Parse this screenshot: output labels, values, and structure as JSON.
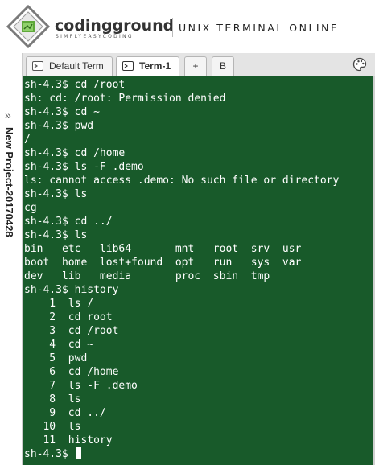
{
  "header": {
    "brand": "codingground",
    "tagline": "SIMPLYEASYCODING",
    "title": "UNIX TERMINAL ONLINE"
  },
  "sidebar": {
    "expand_icon": "double-chevron-right-icon",
    "project_name": "New Project-20170428"
  },
  "tabs": [
    {
      "label": "Default Term",
      "icon": "terminal-icon",
      "active": false
    },
    {
      "label": "Term-1",
      "icon": "terminal-icon",
      "active": true
    }
  ],
  "add_tab_label": "+",
  "b_tab_label": "B",
  "palette_icon": "palette-icon",
  "terminal": {
    "lines": [
      "sh-4.3$ cd /root",
      "sh: cd: /root: Permission denied",
      "sh-4.3$ cd ~",
      "sh-4.3$ pwd",
      "/",
      "sh-4.3$ cd /home",
      "sh-4.3$ ls -F .demo",
      "ls: cannot access .demo: No such file or directory",
      "sh-4.3$ ls",
      "cg",
      "sh-4.3$ cd ../",
      "sh-4.3$ ls",
      "bin   etc   lib64       mnt   root  srv  usr",
      "boot  home  lost+found  opt   run   sys  var",
      "dev   lib   media       proc  sbin  tmp",
      "sh-4.3$ history",
      "    1  ls /",
      "    2  cd root",
      "    3  cd /root",
      "    4  cd ~",
      "    5  pwd",
      "    6  cd /home",
      "    7  ls -F .demo",
      "    8  ls",
      "    9  cd ../",
      "   10  ls",
      "   11  history"
    ],
    "prompt": "sh-4.3$ "
  },
  "colors": {
    "terminal_bg": "#185a2a",
    "terminal_fg": "#ffffff"
  }
}
